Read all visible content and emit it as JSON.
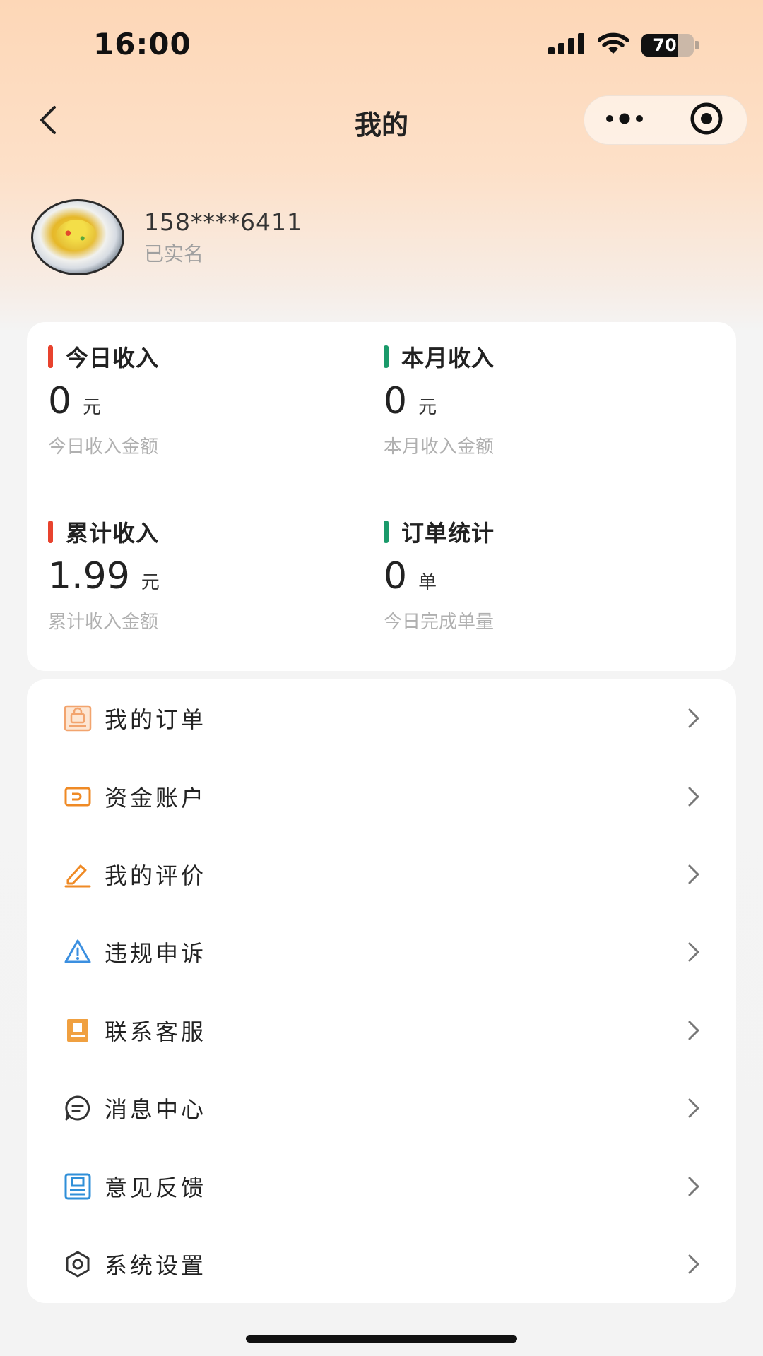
{
  "status_bar": {
    "time": "16:00",
    "battery": "70",
    "battery_level": 0.7,
    "icons": [
      "signal-icon",
      "wifi-icon",
      "battery-icon"
    ]
  },
  "nav": {
    "title": "我的",
    "icons": [
      "back-icon",
      "more-icon",
      "record-icon"
    ]
  },
  "profile": {
    "phone": "158****6411",
    "status": "已实名"
  },
  "stats": [
    {
      "title": "今日收入",
      "value": "0",
      "unit": "元",
      "desc": "今日收入金额",
      "color": "#e8432e"
    },
    {
      "title": "本月收入",
      "value": "0",
      "unit": "元",
      "desc": "本月收入金额",
      "color": "#1a9a6a"
    },
    {
      "title": "累计收入",
      "value": "1.99",
      "unit": "元",
      "desc": "累计收入金额",
      "color": "#e8432e"
    },
    {
      "title": "订单统计",
      "value": "0",
      "unit": "单",
      "desc": "今日完成单量",
      "color": "#1a9a6a"
    }
  ],
  "menu": [
    {
      "label": "我的订单",
      "icon": "order-bag-icon",
      "color": "#f2a46e"
    },
    {
      "label": "资金账户",
      "icon": "wallet-icon",
      "color": "#ef8a25"
    },
    {
      "label": "我的评价",
      "icon": "edit-pen-icon",
      "color": "#ef8a25"
    },
    {
      "label": "违规申诉",
      "icon": "warning-triangle-icon",
      "color": "#3b8fe0"
    },
    {
      "label": "联系客服",
      "icon": "customer-service-book-icon",
      "color": "#f0a040"
    },
    {
      "label": "消息中心",
      "icon": "message-bubble-icon",
      "color": "#333333"
    },
    {
      "label": "意见反馈",
      "icon": "feedback-document-icon",
      "color": "#2f8fd8"
    },
    {
      "label": "系统设置",
      "icon": "settings-hexagon-icon",
      "color": "#333333"
    }
  ]
}
